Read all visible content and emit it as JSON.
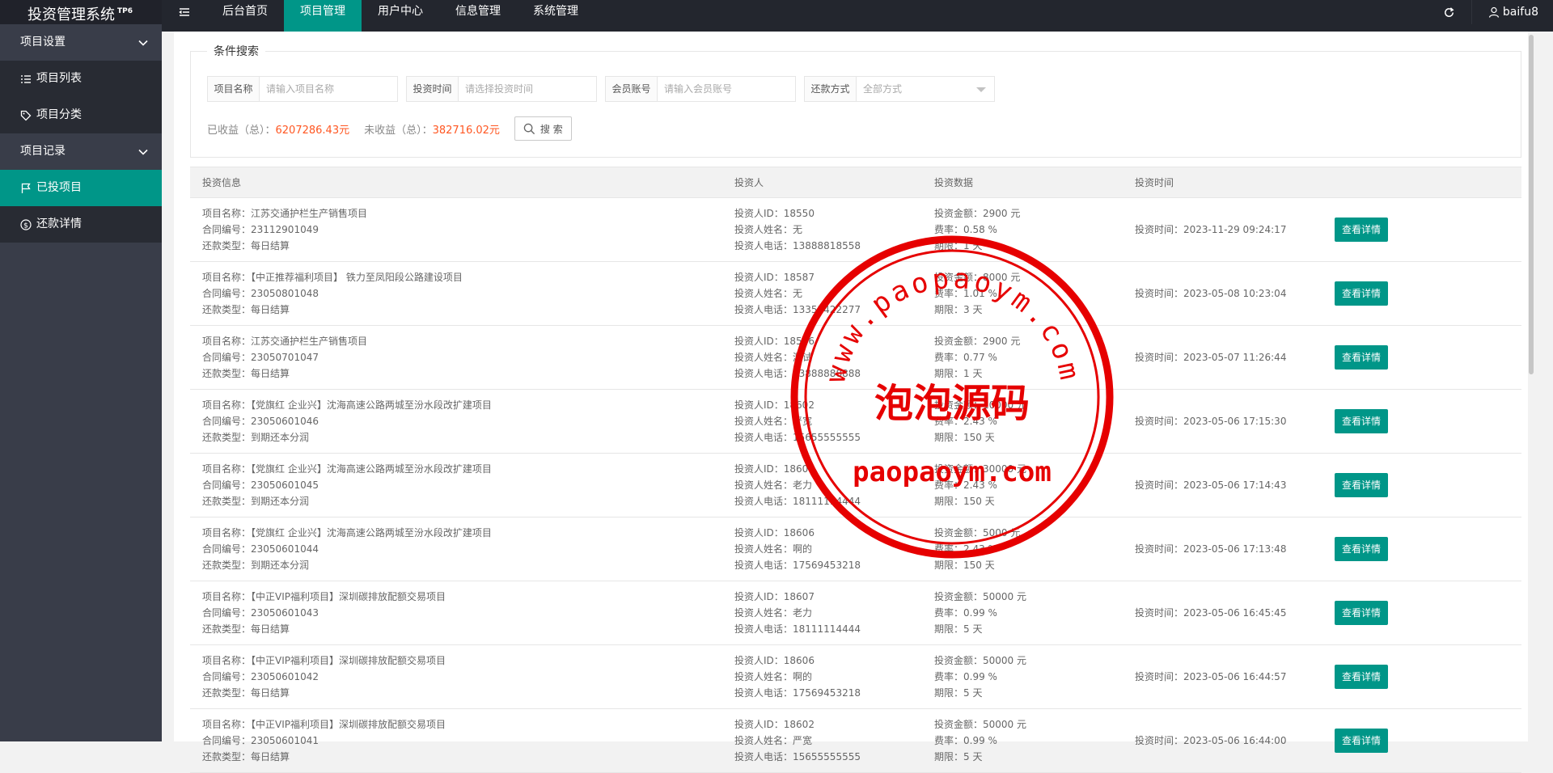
{
  "app": {
    "title": "投资管理系统",
    "badge": "TP6"
  },
  "sidebar": {
    "groups": [
      {
        "label": "项目设置",
        "items": [
          {
            "label": "项目列表",
            "icon": "list-icon"
          },
          {
            "label": "项目分类",
            "icon": "tag-icon"
          }
        ]
      },
      {
        "label": "项目记录",
        "items": [
          {
            "label": "已投项目",
            "icon": "flag-icon"
          },
          {
            "label": "还款详情",
            "icon": "dollar-icon"
          }
        ]
      }
    ],
    "active_item": "已投项目"
  },
  "header": {
    "nav": [
      "后台首页",
      "项目管理",
      "用户中心",
      "信息管理",
      "系统管理"
    ],
    "active_nav": "项目管理",
    "user": "baifu8"
  },
  "search": {
    "legend": "条件搜索",
    "fields": [
      {
        "label": "项目名称",
        "placeholder": "请输入项目名称"
      },
      {
        "label": "投资时间",
        "placeholder": "请选择投资时间"
      },
      {
        "label": "会员账号",
        "placeholder": "请输入会员账号"
      },
      {
        "label": "还款方式",
        "value": "全部方式"
      }
    ],
    "earned_label": "已收益（总）：",
    "earned_value": "6207286.43元",
    "pending_label": "未收益（总）：",
    "pending_value": "382716.02元",
    "button": "搜 索"
  },
  "table": {
    "headers": [
      "投资信息",
      "投资人",
      "投资数据",
      "投资时间",
      ""
    ],
    "button_label": "查看详情",
    "rows": [
      {
        "name": "项目名称：江苏交通护栏生产销售项目",
        "contract": "合同编号：23112901049",
        "type": "还款类型：每日结算",
        "inv_id": "投资人ID：18550",
        "inv_name": "投资人姓名：无",
        "inv_phone": "投资人电话：13888818558",
        "amount": "投资金额：2900 元",
        "rate": "费率：0.58 %",
        "term": "期限：1 天",
        "time": "投资时间：2023-11-29 09:24:17"
      },
      {
        "name": "项目名称：【中正推荐福利项目】 铁力至凤阳段公路建设项目",
        "contract": "合同编号：23050801048",
        "type": "还款类型：每日结算",
        "inv_id": "投资人ID：18587",
        "inv_name": "投资人姓名：无",
        "inv_phone": "投资人电话：13353422277",
        "amount": "投资金额：8000 元",
        "rate": "费率：1.01 %",
        "term": "期限：3 天",
        "time": "投资时间：2023-05-08 10:23:04"
      },
      {
        "name": "项目名称：江苏交通护栏生产销售项目",
        "contract": "合同编号：23050701047",
        "type": "还款类型：每日结算",
        "inv_id": "投资人ID：18556",
        "inv_name": "投资人姓名：测试",
        "inv_phone": "投资人电话：13888888888",
        "amount": "投资金额：2900 元",
        "rate": "费率：0.77 %",
        "term": "期限：1 天",
        "time": "投资时间：2023-05-07 11:26:44"
      },
      {
        "name": "项目名称：【党旗红 企业兴】沈海高速公路两城至汾水段改扩建项目",
        "contract": "合同编号：23050601046",
        "type": "还款类型：到期还本分润",
        "inv_id": "投资人ID：18602",
        "inv_name": "投资人姓名：严宽",
        "inv_phone": "投资人电话：15655555555",
        "amount": "投资金额：10000 元",
        "rate": "费率：2.43 %",
        "term": "期限：150 天",
        "time": "投资时间：2023-05-06 17:15:30"
      },
      {
        "name": "项目名称：【党旗红 企业兴】沈海高速公路两城至汾水段改扩建项目",
        "contract": "合同编号：23050601045",
        "type": "还款类型：到期还本分润",
        "inv_id": "投资人ID：18607",
        "inv_name": "投资人姓名：老力",
        "inv_phone": "投资人电话：18111114444",
        "amount": "投资金额：30000 元",
        "rate": "费率：2.43 %",
        "term": "期限：150 天",
        "time": "投资时间：2023-05-06 17:14:43"
      },
      {
        "name": "项目名称：【党旗红 企业兴】沈海高速公路两城至汾水段改扩建项目",
        "contract": "合同编号：23050601044",
        "type": "还款类型：到期还本分润",
        "inv_id": "投资人ID：18606",
        "inv_name": "投资人姓名：啊的",
        "inv_phone": "投资人电话：17569453218",
        "amount": "投资金额：5000 元",
        "rate": "费率：2.43 %",
        "term": "期限：150 天",
        "time": "投资时间：2023-05-06 17:13:48"
      },
      {
        "name": "项目名称：【中正VIP福利项目】深圳碳排放配额交易项目",
        "contract": "合同编号：23050601043",
        "type": "还款类型：每日结算",
        "inv_id": "投资人ID：18607",
        "inv_name": "投资人姓名：老力",
        "inv_phone": "投资人电话：18111114444",
        "amount": "投资金额：50000 元",
        "rate": "费率：0.99 %",
        "term": "期限：5 天",
        "time": "投资时间：2023-05-06 16:45:45"
      },
      {
        "name": "项目名称：【中正VIP福利项目】深圳碳排放配额交易项目",
        "contract": "合同编号：23050601042",
        "type": "还款类型：每日结算",
        "inv_id": "投资人ID：18606",
        "inv_name": "投资人姓名：啊的",
        "inv_phone": "投资人电话：17569453218",
        "amount": "投资金额：50000 元",
        "rate": "费率：0.99 %",
        "term": "期限：5 天",
        "time": "投资时间：2023-05-06 16:44:57"
      },
      {
        "name": "项目名称：【中正VIP福利项目】深圳碳排放配额交易项目",
        "contract": "合同编号：23050601041",
        "type": "还款类型：每日结算",
        "inv_id": "投资人ID：18602",
        "inv_name": "投资人姓名：严宽",
        "inv_phone": "投资人电话：15655555555",
        "amount": "投资金额：50000 元",
        "rate": "费率：0.99 %",
        "term": "期限：5 天",
        "time": "投资时间：2023-05-06 16:44:00"
      }
    ]
  },
  "watermark": {
    "url_top": "www.paopaoym.com",
    "center": "泡泡源码",
    "url_bottom": "paopaoym.com",
    "color": "#e60000"
  },
  "colors": {
    "primary": "#009688",
    "sidebar": "#393d49",
    "sidebar_sub": "#282b33",
    "header": "#23262e",
    "accent": "#ff5722"
  }
}
